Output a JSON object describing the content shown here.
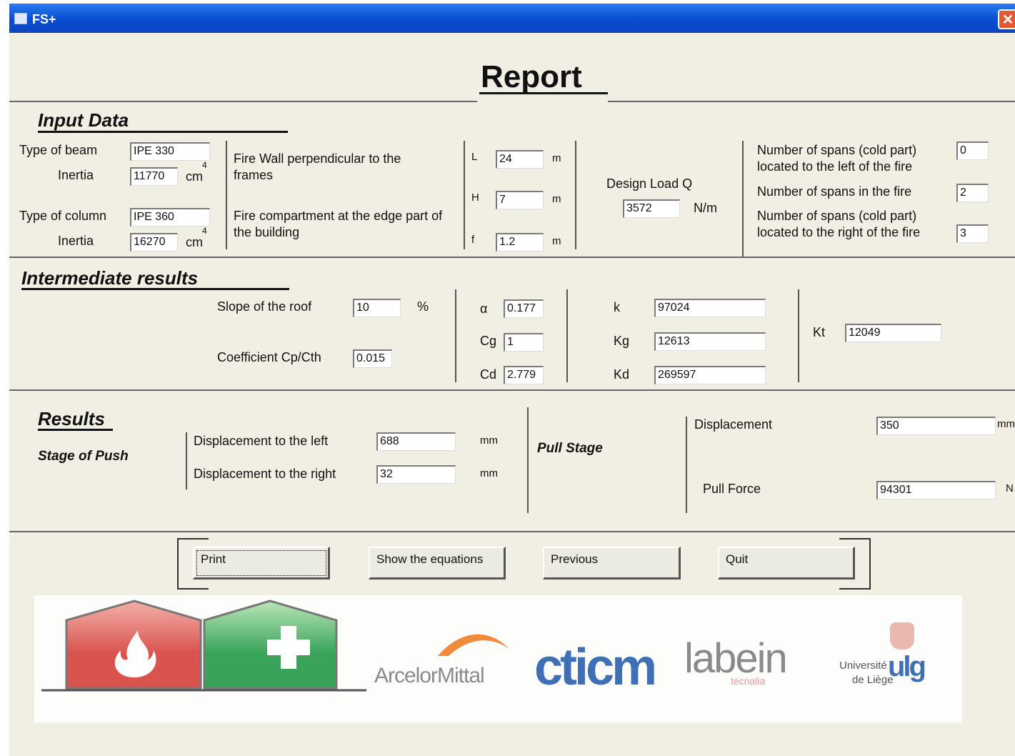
{
  "window": {
    "title": "FS+",
    "close_glyph": "✕"
  },
  "report_title": "Report",
  "input_data": {
    "heading": "Input Data",
    "beam_type_label": "Type of beam",
    "beam_type_value": "IPE 330",
    "beam_inertia_label": "Inertia",
    "beam_inertia_value": "11770",
    "column_type_label": "Type of column",
    "column_type_value": "IPE 360",
    "column_inertia_label": "Inertia",
    "column_inertia_value": "16270",
    "inertia_unit": "cm",
    "inertia_exp": "4",
    "fire_wall_text_1": "Fire Wall perpendicular to the",
    "fire_wall_text_2": "frames",
    "fire_comp_text_1": "Fire compartment at the edge part of",
    "fire_comp_text_2": "the building",
    "L_label": "L",
    "L_value": "24",
    "H_label": "H",
    "H_value": "7",
    "f_label": "f",
    "f_value": "1.2",
    "dim_unit": "m",
    "design_load_label": "Design Load Q",
    "design_load_value": "3572",
    "design_load_unit": "N/m",
    "spans_left_label_1": "Number of spans (cold part)",
    "spans_left_label_2": "located to the left of the fire",
    "spans_left_value": "0",
    "spans_fire_label": "Number of spans in the fire",
    "spans_fire_value": "2",
    "spans_right_label_1": "Number of spans (cold part)",
    "spans_right_label_2": "located to the right of the fire",
    "spans_right_value": "3"
  },
  "intermediate": {
    "heading": "Intermediate results",
    "slope_label": "Slope of the roof",
    "slope_value": "10",
    "slope_unit": "%",
    "coef_label": "Coefficient Cp/Cth",
    "coef_value": "0.015",
    "alpha_label": "α",
    "alpha_value": "0.177",
    "cg_label": "Cg",
    "cg_value": "1",
    "cd_label": "Cd",
    "cd_value": "2.779",
    "k_label": "k",
    "k_value": "97024",
    "kg_label": "Kg",
    "kg_value": "12613",
    "kd_label": "Kd",
    "kd_value": "269597",
    "kt_label": "Kt",
    "kt_value": "12049"
  },
  "results": {
    "heading": "Results",
    "push_stage_label": "Stage of Push",
    "disp_left_label": "Displacement to the left",
    "disp_left_value": "688",
    "disp_right_label": "Displacement to the right",
    "disp_right_value": "32",
    "mm_unit": "mm",
    "pull_stage_label": "Pull Stage",
    "displacement_label": "Displacement",
    "displacement_value": "350",
    "pull_force_label": "Pull Force",
    "pull_force_value": "94301",
    "force_unit": "N"
  },
  "buttons": {
    "print": "Print",
    "show_equations": "Show the equations",
    "previous": "Previous",
    "quit": "Quit"
  },
  "logos": {
    "arcelor": "ArcelorMittal",
    "cticm": "cticm",
    "labein": "labein",
    "labein_sub": "tecnalia",
    "ulg_line1": "Université",
    "ulg_line2": "de Liège",
    "ulg_mark": "ulg",
    "colors": {
      "fire_red": "#d9534f",
      "safe_green": "#3aa35a",
      "arcelor_orange": "#f08a3c",
      "cticm_blue": "#3f6fb5"
    }
  }
}
